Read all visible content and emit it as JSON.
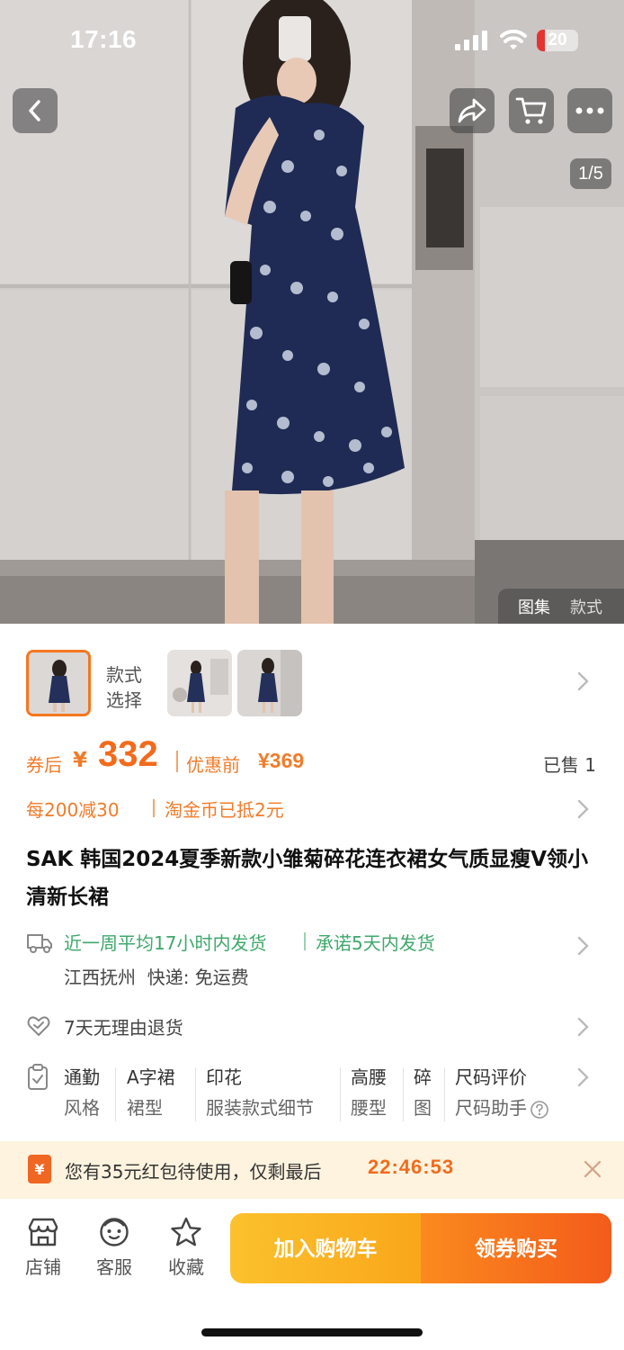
{
  "status_bar": {
    "time": "17:16",
    "battery": "20",
    "battery_level": 0.2
  },
  "gallery": {
    "counter": "1/5",
    "tabs": [
      "图集",
      "款式"
    ]
  },
  "thumbnails": {
    "style_label": "款式\n选择"
  },
  "price": {
    "coupon_label": "券后",
    "currency": "¥",
    "amount": "332",
    "original_label": "优惠前",
    "original_price": "¥369",
    "sold": "已售 1"
  },
  "promo": {
    "discount": "每200减30",
    "coin": "淘金币已抵2元"
  },
  "product": {
    "title": "SAK 韩国2024夏季新款小雏菊碎花连衣裙女气质显瘦V领小清新长裙"
  },
  "shipping": {
    "speed": "近一周平均17小时内发货",
    "promise": "承诺5天内发货",
    "origin": "江西抚州  快递: 免运费"
  },
  "returns": {
    "text": "7天无理由退货"
  },
  "attributes": [
    {
      "value": "通勤",
      "key": "风格"
    },
    {
      "value": "A字裙",
      "key": "裙型"
    },
    {
      "value": "印花",
      "key": "服装款式细节"
    },
    {
      "value": "高腰",
      "key": "腰型"
    },
    {
      "value": "碎",
      "key": "图"
    },
    {
      "value": "尺码评价",
      "key": "尺码助手"
    }
  ],
  "red_packet": {
    "icon": "¥",
    "text": "您有35元红包待使用，仅剩最后",
    "timer": "22:46:53"
  },
  "bottom_bar": {
    "shop": "店铺",
    "service": "客服",
    "favorite": "收藏",
    "add_to_cart": "加入购物车",
    "buy": "领券购买"
  },
  "colors": {
    "accent": "#f26b1d",
    "green": "#3fa86b",
    "cart_button": "#fbc12d",
    "buy_button": "#f45b1b"
  },
  "icons": [
    "back-icon",
    "share-icon",
    "cart-icon",
    "more-icon",
    "truck-icon",
    "heart-shield-icon",
    "clipboard-icon",
    "help-icon",
    "close-icon",
    "shop-icon",
    "service-icon",
    "star-icon"
  ]
}
